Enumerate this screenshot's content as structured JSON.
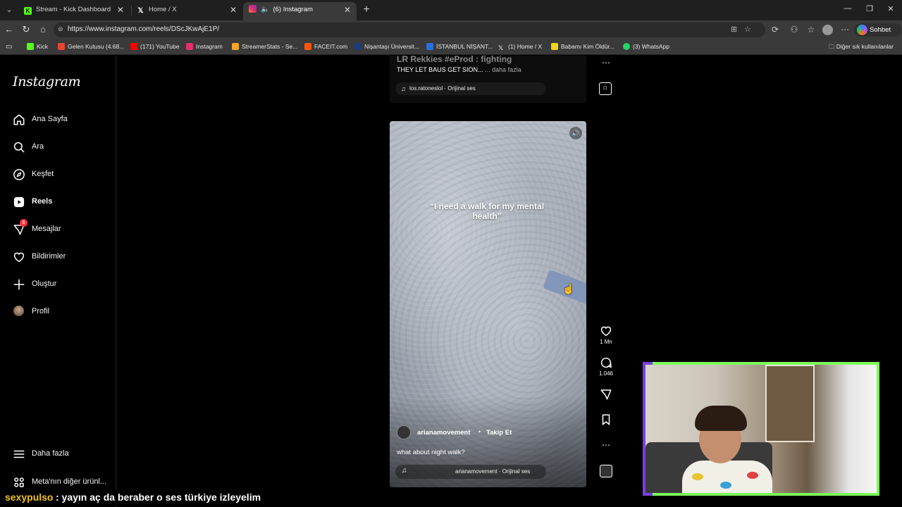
{
  "browser": {
    "tabs": [
      {
        "title": "Stream - Kick Dashboard",
        "icon": "kick-icon"
      },
      {
        "title": "Home / X",
        "icon": "x-icon"
      },
      {
        "title": "(6) Instagram",
        "icon": "instagram-icon",
        "active": true
      }
    ],
    "url": "https://www.instagram.com/reels/DScJKwAjE1P/",
    "copilot_label": "Sohbet et",
    "bookmarks": [
      {
        "label": "Kick",
        "color": "#53fc18"
      },
      {
        "label": "Gelen Kutusu (4.68...",
        "color": "#ea4335"
      },
      {
        "label": "(171) YouTube",
        "color": "#ff0000"
      },
      {
        "label": "Instagram",
        "color": "#e1306c"
      },
      {
        "label": "StreamerStats - Se...",
        "color": "#f5a623"
      },
      {
        "label": "FACEIT.com",
        "color": "#ff5500"
      },
      {
        "label": "Nişantaşı Üniversit...",
        "color": "#1d3d7a"
      },
      {
        "label": "İSTANBUL NİŞANT...",
        "color": "#2a6fdb"
      },
      {
        "label": "(1) Home / X",
        "color": "#ffffff"
      },
      {
        "label": "Babamı Kim Öldür...",
        "color": "#f2d31b"
      },
      {
        "label": "(3) WhatsApp",
        "color": "#25d366"
      }
    ],
    "bookmarks_other": "Diğer sık kullanılanlar"
  },
  "sidebar": {
    "logo": "Instagram",
    "items": [
      {
        "label": "Ana Sayfa",
        "icon": "home-icon"
      },
      {
        "label": "Ara",
        "icon": "search-icon"
      },
      {
        "label": "Keşfet",
        "icon": "compass-icon"
      },
      {
        "label": "Reels",
        "icon": "reels-icon",
        "active": true
      },
      {
        "label": "Mesajlar",
        "icon": "messenger-icon",
        "badge": "6"
      },
      {
        "label": "Bildirimler",
        "icon": "heart-icon"
      },
      {
        "label": "Oluştur",
        "icon": "plus-icon"
      },
      {
        "label": "Profil",
        "icon": "avatar"
      }
    ],
    "more": "Daha fazla",
    "meta": "Meta'nın diğer ürünl..."
  },
  "prev_reel": {
    "title": "LR Rekkies #eProd : fighting",
    "caption": "THEY LET BAUS GET SION...",
    "more": "... daha fazla",
    "audio": "los.ratoneslol · Orijinal ses"
  },
  "reel": {
    "overlay_text": "“I need a walk for my mental health”",
    "username": "arianamovement",
    "separator": "•",
    "follow": "Takip Et",
    "caption": "what about night walk?",
    "audio": "arianamovement · Orijinal ses",
    "likes": "1 Mn",
    "comments": "1.046"
  },
  "chat": {
    "user": "sexypulso",
    "message": ": yayın aç da beraber o ses türkiye izleyelim"
  }
}
